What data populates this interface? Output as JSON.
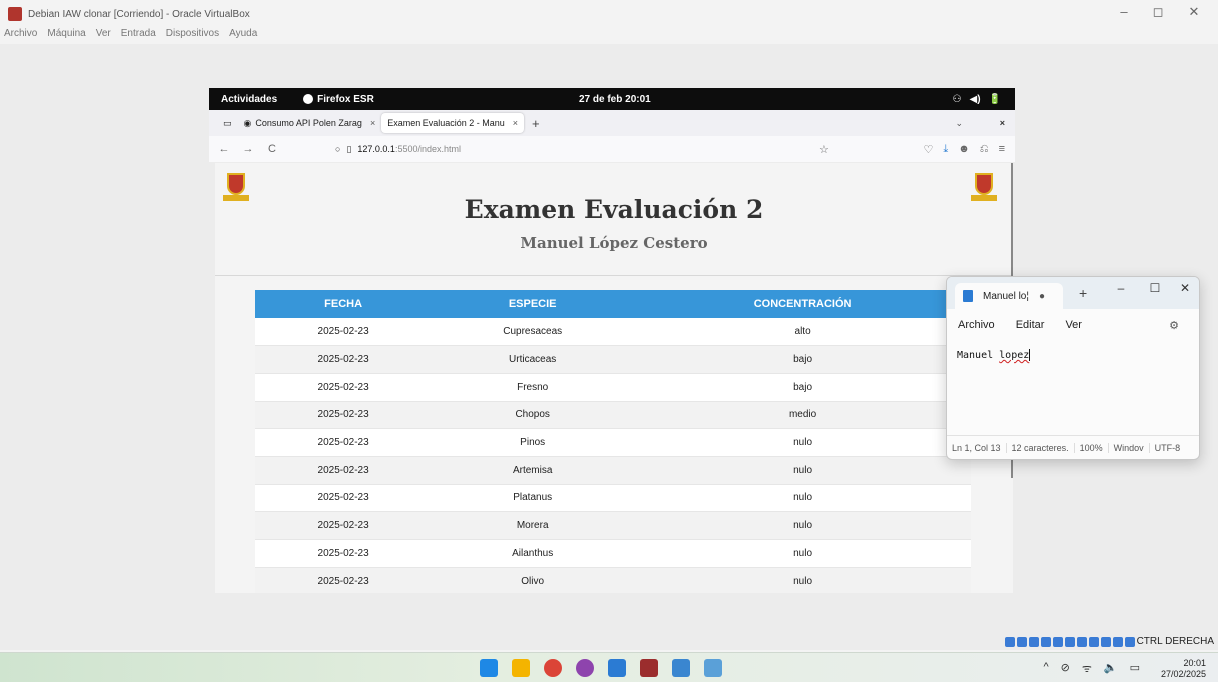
{
  "host": {
    "title": "Debian IAW clonar [Corriendo] - Oracle VirtualBox",
    "menu": [
      "Archivo",
      "Máquina",
      "Ver",
      "Entrada",
      "Dispositivos",
      "Ayuda"
    ],
    "controls": {
      "minimize": "–",
      "restore": "◻",
      "close": "✕"
    },
    "status_text": "CTRL DERECHA",
    "taskbar": {
      "icons": [
        "windows-start-icon",
        "file-explorer-icon",
        "chrome-icon",
        "browser-icon",
        "vscode-icon",
        "virtualbox-icon",
        "notepad-icon",
        "snipping-tool-icon"
      ],
      "tray": [
        "^",
        "⊘",
        "ᯤ",
        "🔈",
        "▭"
      ],
      "time": "20:01",
      "date": "27/02/2025"
    }
  },
  "guest": {
    "topbar": {
      "activities": "Actividades",
      "app": "Firefox ESR",
      "clock": "27 de feb  20:01",
      "tray": [
        "⚇",
        "◀)",
        "🔋"
      ]
    },
    "browser": {
      "tabs": [
        {
          "label": "Consumo API Polen Zarag",
          "active": false
        },
        {
          "label": "Examen Evaluación 2 - Manu",
          "active": true
        }
      ],
      "new_tab": "+",
      "list_all": "⌄",
      "close_window": "×",
      "nav": {
        "back": "←",
        "forward": "→",
        "reload": "C"
      },
      "url": {
        "host": "127.0.0.1",
        "path": ":5500/index.html"
      },
      "tools": [
        "♡",
        "⤓",
        "☻",
        "⎌",
        "≡"
      ]
    },
    "page": {
      "title": "Examen Evaluación 2",
      "subtitle": "Manuel López Cestero",
      "table": {
        "headers": [
          "FECHA",
          "ESPECIE",
          "CONCENTRACIÓN"
        ],
        "rows": [
          [
            "2025-02-23",
            "Cupresaceas",
            "alto"
          ],
          [
            "2025-02-23",
            "Urticaceas",
            "bajo"
          ],
          [
            "2025-02-23",
            "Fresno",
            "bajo"
          ],
          [
            "2025-02-23",
            "Chopos",
            "medio"
          ],
          [
            "2025-02-23",
            "Pinos",
            "nulo"
          ],
          [
            "2025-02-23",
            "Artemisa",
            "nulo"
          ],
          [
            "2025-02-23",
            "Platanus",
            "nulo"
          ],
          [
            "2025-02-23",
            "Morera",
            "nulo"
          ],
          [
            "2025-02-23",
            "Ailanthus",
            "nulo"
          ],
          [
            "2025-02-23",
            "Olivo",
            "nulo"
          ]
        ]
      }
    }
  },
  "notepad": {
    "tab_label": "Manuel lo¦",
    "modified_dot": "●",
    "add": "+",
    "controls": {
      "minimize": "–",
      "maximize": "☐",
      "close": "✕"
    },
    "menu": [
      "Archivo",
      "Editar",
      "Ver"
    ],
    "content_word1": "Manuel ",
    "content_word2": "lopez",
    "status": [
      "Ln 1, Col 13",
      "12 caracteres.",
      "100%",
      "Windov",
      "UTF-8"
    ]
  },
  "colors": {
    "table_header": "#3796d9",
    "gnome_bar": "#0d0d0d",
    "notepad_icon": "#2b7bd3"
  }
}
